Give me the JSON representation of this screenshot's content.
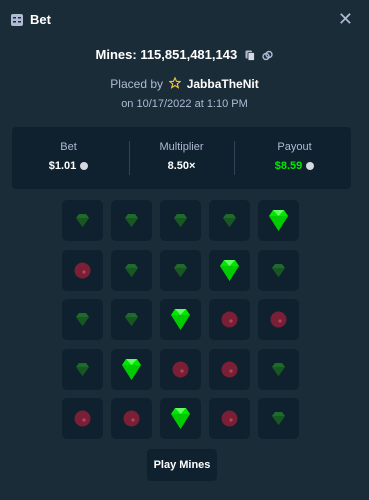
{
  "header": {
    "title": "Bet",
    "icon": "bet-slip-icon",
    "close_icon": "close-icon",
    "close_glyph": "✕"
  },
  "info": {
    "mines_label": "Mines: 115,851,481,143",
    "copy_icon": "copy-icon",
    "link_icon": "link-icon",
    "placed_by_label": "Placed by",
    "star_icon": "star-icon",
    "username": "JabbaTheNit",
    "date": "on 10/17/2022 at 1:10 PM"
  },
  "stats": {
    "bet": {
      "label": "Bet",
      "value": "$1.01"
    },
    "multiplier": {
      "label": "Multiplier",
      "value": "8.50×"
    },
    "payout": {
      "label": "Payout",
      "value": "$8.59"
    }
  },
  "grid": {
    "rows": 5,
    "cols": 5,
    "tiles": [
      "gem",
      "gem",
      "gem",
      "gem",
      "gem-revealed",
      "mine",
      "gem",
      "gem",
      "gem-revealed",
      "gem",
      "gem",
      "gem",
      "gem-revealed",
      "mine",
      "mine",
      "gem",
      "gem-revealed",
      "mine",
      "mine",
      "gem",
      "mine",
      "mine",
      "gem-revealed",
      "mine",
      "gem"
    ]
  },
  "actions": {
    "play_label": "Play Mines"
  },
  "colors": {
    "background": "#1a2c38",
    "panel": "#0f212e",
    "muted_text": "#b1bad3",
    "payout_green": "#00e701",
    "gem_bright": "#00e701",
    "gem_dim": "#1e6b2a",
    "mine": "#7a1f35"
  }
}
